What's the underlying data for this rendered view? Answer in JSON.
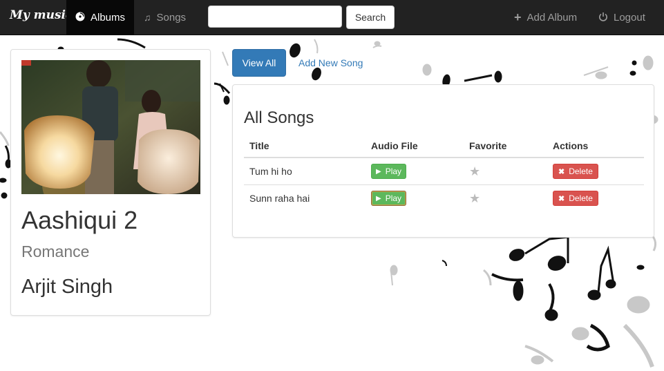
{
  "navbar": {
    "brand": "My music",
    "items": [
      {
        "label": "Albums",
        "icon": "disc-icon",
        "active": true
      },
      {
        "label": "Songs",
        "icon": "music-note-icon",
        "active": false
      }
    ],
    "search": {
      "value": "",
      "placeholder": "",
      "button_label": "Search"
    },
    "right_items": [
      {
        "label": "Add Album",
        "icon": "plus-icon"
      },
      {
        "label": "Logout",
        "icon": "power-icon"
      }
    ]
  },
  "album": {
    "title": "Aashiqui 2",
    "genre": "Romance",
    "artist": "Arjit Singh"
  },
  "actions": {
    "view_all_label": "View All",
    "add_song_label": "Add New Song"
  },
  "songs_panel": {
    "heading": "All Songs",
    "columns": [
      "Title",
      "Audio File",
      "Favorite",
      "Actions"
    ],
    "rows": [
      {
        "title": "Tum hi ho",
        "play_label": "Play",
        "favorite_icon": "star-icon",
        "delete_label": "Delete"
      },
      {
        "title": "Sunn raha hai",
        "play_label": "Play",
        "favorite_icon": "star-icon",
        "delete_label": "Delete"
      }
    ]
  },
  "colors": {
    "navbar_bg": "#222222",
    "primary": "#337ab7",
    "success": "#5cb85c",
    "danger": "#d9534f"
  }
}
